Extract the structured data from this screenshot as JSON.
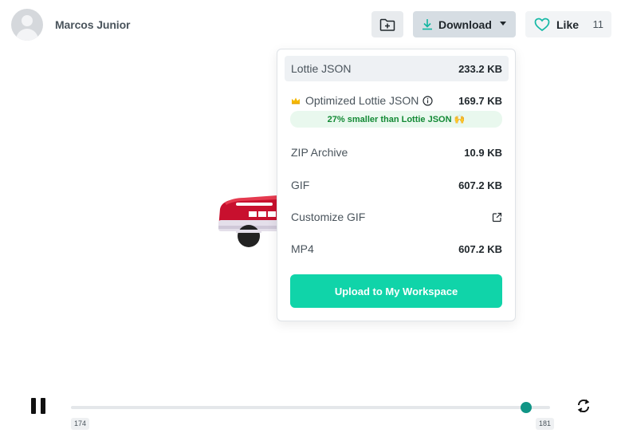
{
  "author": {
    "name": "Marcos Junior"
  },
  "header": {
    "download_label": "Download",
    "like_label": "Like",
    "like_count": "11",
    "accent": "#10d4a9"
  },
  "dropdown": {
    "items": [
      {
        "name": "Lottie JSON",
        "size": "233.2 KB"
      },
      {
        "name": "Optimized Lottie JSON",
        "size": "169.7 KB",
        "badge": "27% smaller than Lottie JSON 🙌"
      },
      {
        "name": "ZIP Archive",
        "size": "10.9 KB"
      },
      {
        "name": "GIF",
        "size": "607.2 KB"
      },
      {
        "name": "Customize GIF"
      },
      {
        "name": "MP4",
        "size": "607.2 KB"
      }
    ],
    "upload_label": "Upload to My Workspace"
  },
  "player": {
    "start_frame": "174",
    "end_frame": "181",
    "progress_fraction": 0.95,
    "playing": true
  }
}
